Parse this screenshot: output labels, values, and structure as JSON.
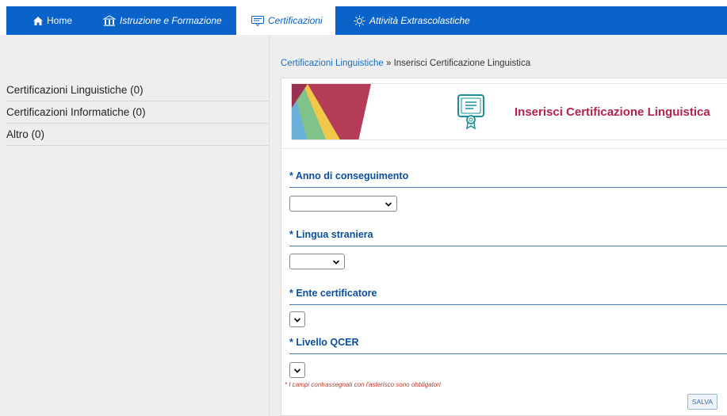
{
  "nav": {
    "items": [
      {
        "label": "Home"
      },
      {
        "label": "Istruzione e Formazione"
      },
      {
        "label": "Certificazioni"
      },
      {
        "label": "Attività Extrascolastiche"
      }
    ],
    "active_color": "#0a63c9"
  },
  "sidebar": {
    "items": [
      {
        "label": "Certificazioni Linguistiche (0)"
      },
      {
        "label": "Certificazioni Informatiche (0)"
      },
      {
        "label": "Altro (0)"
      }
    ]
  },
  "breadcrumb": {
    "parent": "Certificazioni Linguistiche",
    "separator": " » ",
    "current": "Inserisci Certificazione Linguistica"
  },
  "banner": {
    "title": "Inserisci Certificazione Linguistica",
    "title_color": "#b3234a"
  },
  "form": {
    "fields": [
      {
        "label": "* Anno di conseguimento",
        "value": ""
      },
      {
        "label": "* Lingua straniera",
        "value": ""
      },
      {
        "label": "* Ente certificatore",
        "value": ""
      },
      {
        "label": "* Livello QCER",
        "value": ""
      }
    ],
    "required_note": "* I campi contrassegnati con l'asterisco sono obbligatori",
    "save_label": "SALVA"
  }
}
